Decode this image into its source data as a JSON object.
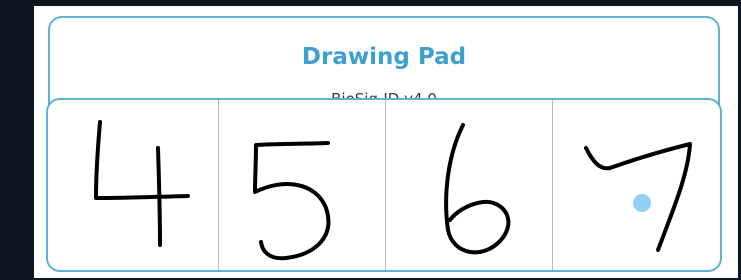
{
  "header": {
    "title": "Drawing Pad",
    "subtitle": "BioSig-ID v4.0"
  },
  "drawing_pad": {
    "cells": [
      {
        "digit": "4"
      },
      {
        "digit": "5"
      },
      {
        "digit": "6"
      },
      {
        "digit": "7"
      }
    ],
    "cursor_dot_color": "#8fd0f3",
    "border_color": "#5fb2d4",
    "stroke_color": "#000000"
  }
}
